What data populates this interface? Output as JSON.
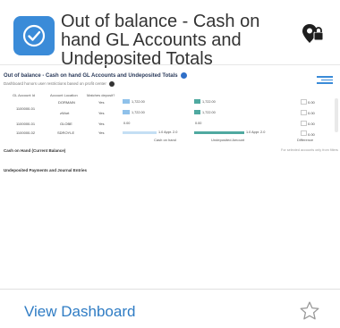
{
  "header": {
    "title": "Out of balance - Cash on hand GL Accounts and Undeposited Totals",
    "app_icon": "checkmark-circle-icon",
    "lock_icon": "location-lock-icon",
    "accent_color": "#3a8bd8"
  },
  "preview": {
    "title": "Out of balance - Cash on hand GL Accounts and Undeposited Totals",
    "subtitle": "Dashboard honors user restrictions based on profit center",
    "columns": [
      "GL Account Id",
      "Account Location",
      "Matches deposit?"
    ],
    "rows": [
      {
        "account": "1100000-01",
        "location": "DORMAIN",
        "matches": "Yes",
        "cash": "1,722.00",
        "undeposited": "1,722.00",
        "diff": "0.00"
      },
      {
        "account": "",
        "location": "zWort",
        "matches": "Yes",
        "cash": "1,722.00",
        "undeposited": "1,722.00",
        "diff": "0.00"
      },
      {
        "account": "1100000-01",
        "location": "GLOBE",
        "matches": "Yes",
        "cash": "0.00",
        "undeposited": "0.00",
        "diff": "0.00"
      },
      {
        "account": "1100000-02",
        "location": "SDROYLE",
        "matches": "Yes",
        "cash": "",
        "undeposited": "",
        "diff": "0.00"
      }
    ],
    "cash_axis_tick": "1.0 Appr. 2.0",
    "undeposited_axis_tick": "1.0 Appr. 2.0",
    "axis_labels": {
      "cash": "Cash on hand",
      "undeposited": "Undeposited Amount",
      "diff": "Difference"
    },
    "note": "For selected accounts only from filters",
    "section_cash": "Cash on Hand (Current Balance)",
    "section_undeposited": "Undeposited Payments and Journal Entries",
    "bar_colors": {
      "cash": "#8fc1ea",
      "undeposited": "#4fa9a0"
    }
  },
  "footer": {
    "view_label": "View Dashboard",
    "star_icon": "star-outline-icon"
  }
}
